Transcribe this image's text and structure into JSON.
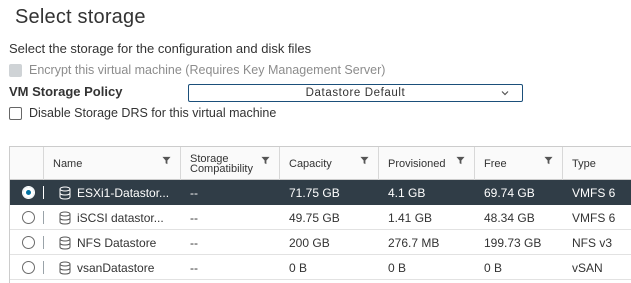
{
  "page": {
    "title": "Select storage",
    "subtitle": "Select the storage for the configuration and disk files"
  },
  "encrypt": {
    "label": "Encrypt this virtual machine (Requires Key Management Server)",
    "checked": false,
    "disabled": true
  },
  "policy": {
    "label": "VM Storage Policy",
    "value": "Datastore Default"
  },
  "drs": {
    "label": "Disable Storage DRS for this virtual machine",
    "checked": false
  },
  "table": {
    "columns": [
      {
        "label": "Name"
      },
      {
        "label": "Storage Compatibility"
      },
      {
        "label": "Capacity"
      },
      {
        "label": "Provisioned"
      },
      {
        "label": "Free"
      },
      {
        "label": "Type"
      }
    ],
    "rows": [
      {
        "name": "ESXi1-Datastor...",
        "compat": "--",
        "capacity": "71.75 GB",
        "provisioned": "4.1 GB",
        "free": "69.74 GB",
        "type": "VMFS 6",
        "selected": true
      },
      {
        "name": "iSCSI datastor...",
        "compat": "--",
        "capacity": "49.75 GB",
        "provisioned": "1.41 GB",
        "free": "48.34 GB",
        "type": "VMFS 6",
        "selected": false
      },
      {
        "name": "NFS Datastore",
        "compat": "--",
        "capacity": "200 GB",
        "provisioned": "276.7 MB",
        "free": "199.73 GB",
        "type": "NFS v3",
        "selected": false
      },
      {
        "name": "vsanDatastore",
        "compat": "--",
        "capacity": "0 B",
        "provisioned": "0 B",
        "free": "0 B",
        "type": "vSAN",
        "selected": false
      }
    ]
  },
  "icons": {
    "filter": "filter-icon",
    "datastore": "datastore-icon",
    "dropdown": "chevron-down-icon"
  },
  "colors": {
    "selected_row": "#303d47",
    "radio_selected": "#0072a3",
    "select_border": "#1b4f7a"
  }
}
